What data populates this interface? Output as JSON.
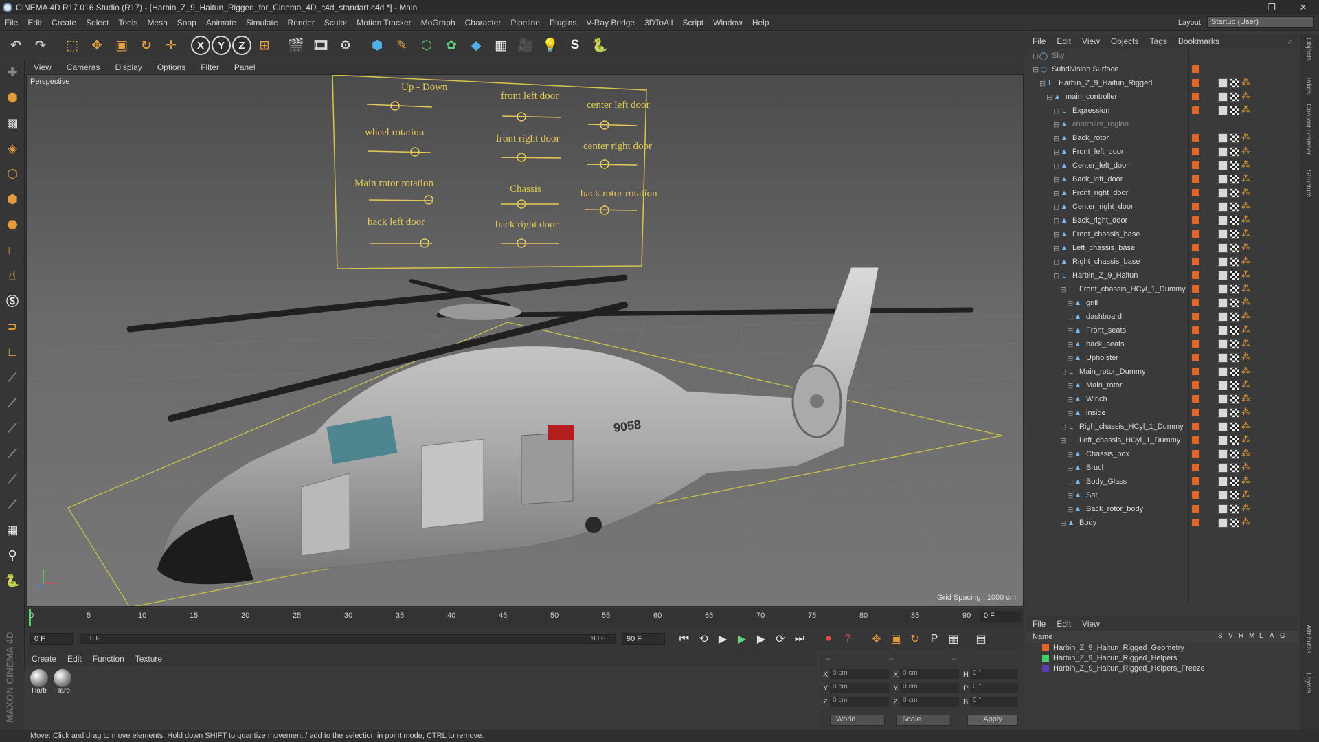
{
  "window": {
    "title": "CINEMA 4D R17.016 Studio (R17) - [Harbin_Z_9_Haitun_Rigged_for_Cinema_4D_c4d_standart.c4d *] - Main",
    "minimize": "–",
    "restore": "❐",
    "close": "✕"
  },
  "menubar": {
    "items": [
      "File",
      "Edit",
      "Create",
      "Select",
      "Tools",
      "Mesh",
      "Snap",
      "Animate",
      "Simulate",
      "Render",
      "Sculpt",
      "Motion Tracker",
      "MoGraph",
      "Character",
      "Pipeline",
      "Plugins",
      "V-Ray Bridge",
      "3DToAll",
      "Script",
      "Window",
      "Help"
    ],
    "layout_label": "Layout:",
    "layout_value": "Startup (User)"
  },
  "toolbar": {
    "undo": "↶",
    "redo": "↷",
    "live_select": "⬚",
    "move": "✥",
    "scale": "▣",
    "rotate": "↻",
    "other": "✛",
    "x_axis": "X",
    "y_axis": "Y",
    "z_axis": "Z",
    "coord": "⊞",
    "render_view": "🎬",
    "render_pic": "🎞",
    "render_settings": "⚙",
    "cube": "⬢",
    "pen": "✎",
    "subdiv": "⬡",
    "array": "✿",
    "deformer": "◆",
    "floor": "▦",
    "camera": "🎥",
    "light": "💡",
    "scripting": "S",
    "python": "🐍"
  },
  "viewport": {
    "menu": [
      "View",
      "Cameras",
      "Display",
      "Options",
      "Filter",
      "Panel"
    ],
    "label": "Perspective",
    "grid_spacing": "Grid Spacing : 1000 cm",
    "controls": [
      {
        "label": "Up - Down"
      },
      {
        "label": "front left door"
      },
      {
        "label": "center left door"
      },
      {
        "label": "wheel rotation"
      },
      {
        "label": "front right door"
      },
      {
        "label": "center right door"
      },
      {
        "label": "Main rotor rotation"
      },
      {
        "label": "Chassis"
      },
      {
        "label": "back rotor rotation"
      },
      {
        "label": "back left door"
      },
      {
        "label": "back right door"
      }
    ],
    "tail_code": "9058"
  },
  "timeline": {
    "ticks": [
      "0",
      "5",
      "10",
      "15",
      "20",
      "25",
      "30",
      "35",
      "40",
      "45",
      "50",
      "55",
      "60",
      "65",
      "70",
      "75",
      "80",
      "85",
      "90"
    ],
    "frame_end": "0 F"
  },
  "playbar": {
    "start_frame": "0 F",
    "slider_start": "0 F",
    "slider_end": "90 F",
    "end_frame": "90 F",
    "to_start": "⏮",
    "prev_key": "⟲",
    "prev_frame": "◀",
    "play": "▶",
    "next_frame": "▶",
    "next_key": "⟳",
    "to_end": "⏭",
    "record": "⏺",
    "autokey": "?",
    "keys": "✥",
    "scale_key": "▣",
    "rot_key": "↻",
    "param_key": "P",
    "grid": "▦",
    "timeline_btn": "▤"
  },
  "material_manager": {
    "menu": [
      "Create",
      "Edit",
      "Function",
      "Texture"
    ],
    "materials": [
      {
        "name": "Harb"
      },
      {
        "name": "Harb"
      }
    ],
    "logo": "MAXON CINEMA 4D"
  },
  "coordinates": {
    "header_left": "--",
    "header_mid": "--",
    "header_right": "--",
    "rows": [
      {
        "a": "X",
        "av": "0 cm",
        "b": "X",
        "bv": "0 cm",
        "c": "H",
        "cv": "0 °"
      },
      {
        "a": "Y",
        "av": "0 cm",
        "b": "Y",
        "bv": "0 cm",
        "c": "P",
        "cv": "0 °"
      },
      {
        "a": "Z",
        "av": "0 cm",
        "b": "Z",
        "bv": "0 cm",
        "c": "B",
        "cv": "0 °"
      }
    ],
    "mode_world": "World",
    "mode_scale": "Scale",
    "apply": "Apply"
  },
  "status": {
    "text": "Move: Click and drag to move elements. Hold down SHIFT to quantize movement / add to the selection in point mode, CTRL to remove."
  },
  "object_manager": {
    "menu": [
      "File",
      "Edit",
      "View",
      "Objects",
      "Tags",
      "Bookmarks"
    ],
    "objects": [
      {
        "name": "Sky",
        "indent": 0,
        "icon": "◯",
        "dot": false
      },
      {
        "name": "Subdivision Surface",
        "indent": 0,
        "icon": "⬡",
        "dot": true
      },
      {
        "name": "Harbin_Z_9_Haitun_Rigged",
        "indent": 1,
        "icon": "L",
        "dot": true
      },
      {
        "name": "main_controller",
        "indent": 2,
        "icon": "▲",
        "dot": true
      },
      {
        "name": "Expression",
        "indent": 3,
        "icon": "L",
        "dot": true
      },
      {
        "name": "controller_region",
        "indent": 3,
        "icon": "▲",
        "dot": false
      },
      {
        "name": "Back_rotor",
        "indent": 3,
        "icon": "▲",
        "dot": true
      },
      {
        "name": "Front_left_door",
        "indent": 3,
        "icon": "▲",
        "dot": true
      },
      {
        "name": "Center_left_door",
        "indent": 3,
        "icon": "▲",
        "dot": true
      },
      {
        "name": "Back_left_door",
        "indent": 3,
        "icon": "▲",
        "dot": true
      },
      {
        "name": "Front_right_door",
        "indent": 3,
        "icon": "▲",
        "dot": true
      },
      {
        "name": "Center_right_door",
        "indent": 3,
        "icon": "▲",
        "dot": true
      },
      {
        "name": "Back_right_door",
        "indent": 3,
        "icon": "▲",
        "dot": true
      },
      {
        "name": "Front_chassis_base",
        "indent": 3,
        "icon": "▲",
        "dot": true
      },
      {
        "name": "Left_chassis_base",
        "indent": 3,
        "icon": "▲",
        "dot": true
      },
      {
        "name": "Right_chassis_base",
        "indent": 3,
        "icon": "▲",
        "dot": true
      },
      {
        "name": "Harbin_Z_9_Haitun",
        "indent": 3,
        "icon": "L",
        "dot": true
      },
      {
        "name": "Front_chassis_HCyl_1_Dummy",
        "indent": 4,
        "icon": "L",
        "dot": true
      },
      {
        "name": "grill",
        "indent": 5,
        "icon": "▲",
        "dot": true
      },
      {
        "name": "dashboard",
        "indent": 5,
        "icon": "▲",
        "dot": true
      },
      {
        "name": "Front_seats",
        "indent": 5,
        "icon": "▲",
        "dot": true
      },
      {
        "name": "back_seats",
        "indent": 5,
        "icon": "▲",
        "dot": true
      },
      {
        "name": "Upholster",
        "indent": 5,
        "icon": "▲",
        "dot": true
      },
      {
        "name": "Main_rotor_Dummy",
        "indent": 4,
        "icon": "L",
        "dot": true
      },
      {
        "name": "Main_rotor",
        "indent": 5,
        "icon": "▲",
        "dot": true
      },
      {
        "name": "Winch",
        "indent": 5,
        "icon": "▲",
        "dot": true
      },
      {
        "name": "inside",
        "indent": 5,
        "icon": "▲",
        "dot": true
      },
      {
        "name": "Righ_chassis_HCyl_1_Dummy",
        "indent": 4,
        "icon": "L",
        "dot": true
      },
      {
        "name": "Left_chassis_HCyl_1_Dummy",
        "indent": 4,
        "icon": "L",
        "dot": true
      },
      {
        "name": "Chassis_box",
        "indent": 5,
        "icon": "▲",
        "dot": true
      },
      {
        "name": "Bruch",
        "indent": 5,
        "icon": "▲",
        "dot": true
      },
      {
        "name": "Body_Glass",
        "indent": 5,
        "icon": "▲",
        "dot": true
      },
      {
        "name": "Sat",
        "indent": 5,
        "icon": "▲",
        "dot": true
      },
      {
        "name": "Back_rotor_body",
        "indent": 5,
        "icon": "▲",
        "dot": true
      },
      {
        "name": "Body",
        "indent": 4,
        "icon": "▲",
        "dot": true
      }
    ]
  },
  "right_tabs": [
    "Objects",
    "Takes",
    "Content Browser",
    "Structure",
    "Attributes",
    "Layers"
  ],
  "layer_manager": {
    "menu": [
      "File",
      "Edit",
      "View"
    ],
    "name_header": "Name",
    "col_headers": [
      "S",
      "V",
      "R",
      "M",
      "L",
      "A",
      "G"
    ],
    "layers": [
      {
        "name": "Harbin_Z_9_Haitun_Rigged_Geometry",
        "color": "#e0662a"
      },
      {
        "name": "Harbin_Z_9_Haitun_Rigged_Helpers",
        "color": "#3fcf6a"
      },
      {
        "name": "Harbin_Z_9_Haitun_Rigged_Helpers_Freeze",
        "color": "#5a3fb0"
      }
    ]
  }
}
